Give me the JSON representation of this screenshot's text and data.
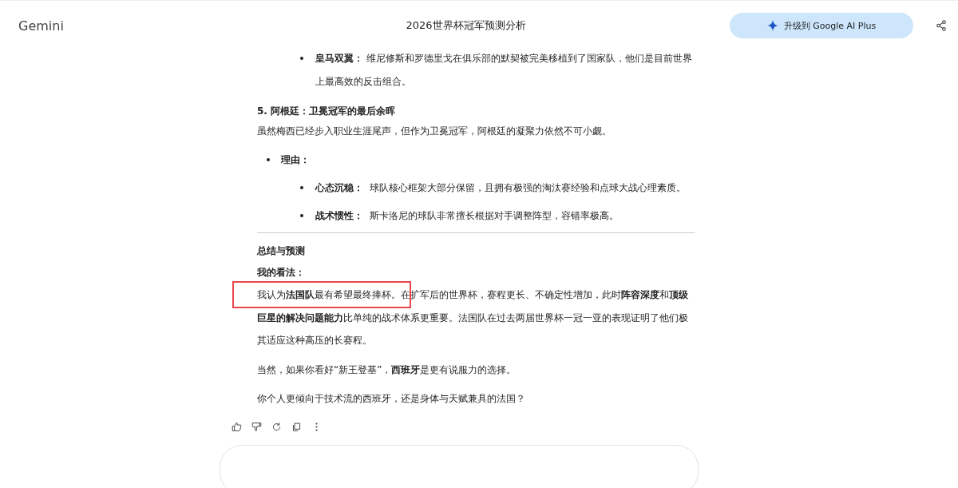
{
  "header": {
    "brand": "Gemini",
    "title": "2026世界杯冠军预测分析",
    "upgrade_button": "升级到 Google AI Plus"
  },
  "content": {
    "top_bullets": [
      {
        "term": "皇马双翼：",
        "text": "维尼修斯和罗德里戈在俱乐部的默契被完美移植到了国家队，他们是目前世界上最高效的反击组合。"
      }
    ],
    "section_heading": "5. 阿根廷：卫冕冠军的最后余晖",
    "section_intro": "虽然梅西已经步入职业生涯尾声，但作为卫冕冠军，阿根廷的凝聚力依然不可小觑。",
    "reason_label": "理由：",
    "reasons": [
      {
        "term": "心态沉稳：",
        "text": "球队核心框架大部分保留，且拥有极强的淘汰赛经验和点球大战心理素质。"
      },
      {
        "term": "战术惯性：",
        "text": "斯卡洛尼的球队非常擅长根据对手调整阵型，容错率极高。"
      }
    ],
    "summary_heading": "总结与预测",
    "opinion_label": "我的看法：",
    "paragraphs": [
      {
        "text": "我认为**法国队**最有希望最终捧杯。在扩军后的世界杯，赛程更长、不确定性增加，此时**阵容深度**和**顶级巨星的解决问题能力**比单纯的战术体系更重要。法国队在过去两届世界杯一冠一亚的表现证明了他们极其适应这种高压的长赛程。",
        "highlight_box": true
      },
      {
        "text": "当然，如果你看好“新王登基”，**西班牙**是更有说服力的选择。",
        "highlight_box": false
      },
      {
        "text": "你个人更倾向于技术流的西班牙，还是身体与天赋兼具的法国？",
        "highlight_box": false
      }
    ]
  },
  "actions": [
    {
      "kind": "thumb-up"
    },
    {
      "kind": "thumb-down"
    },
    {
      "kind": "redo"
    },
    {
      "kind": "copy"
    },
    {
      "kind": "more"
    }
  ]
}
